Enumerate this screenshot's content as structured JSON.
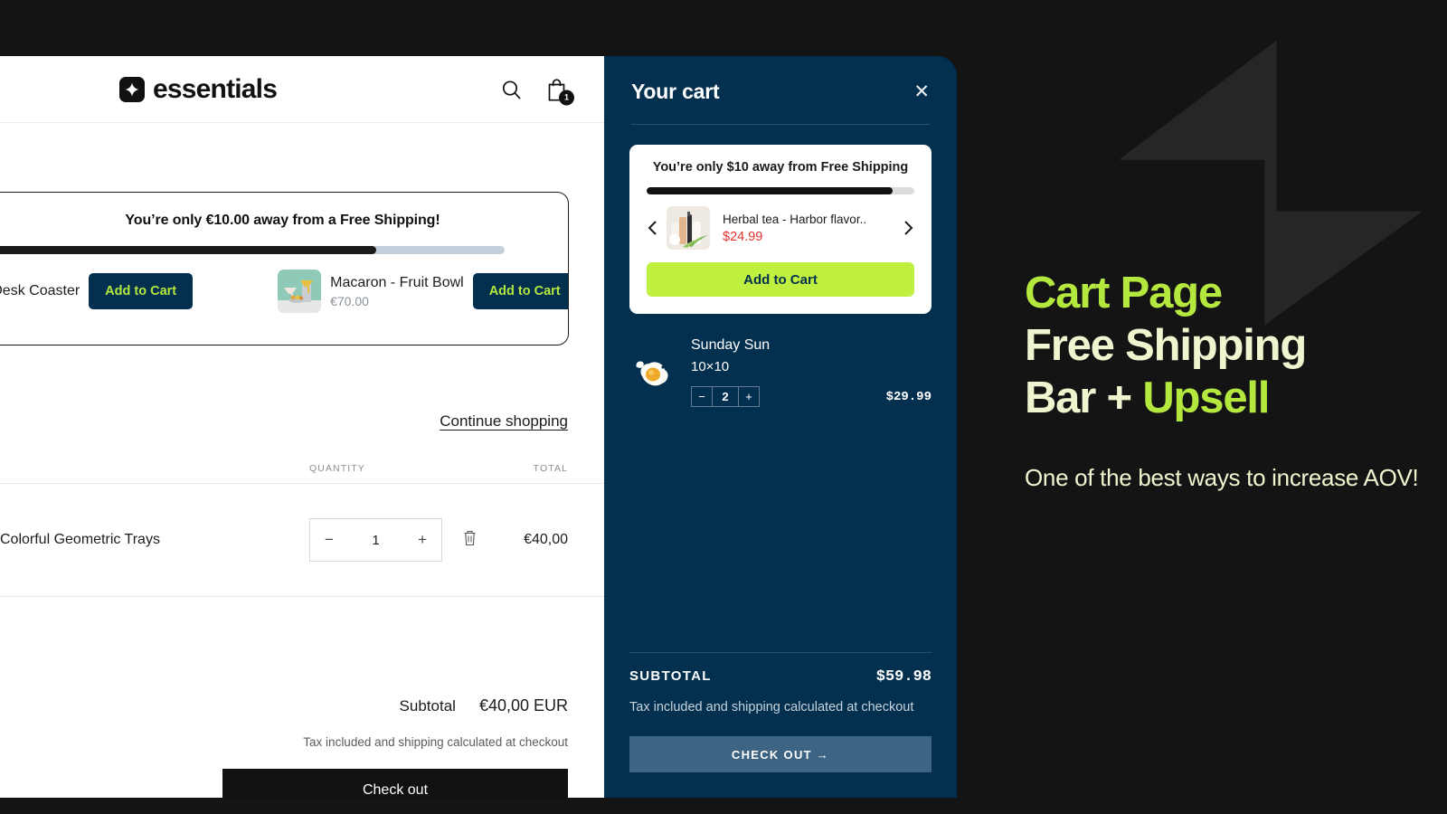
{
  "theme": {
    "page_bg": "#141414",
    "bolt": "#262626",
    "navy": "#04304f",
    "accent_green": "#b5e83f",
    "upsell_green": "#c0f03f",
    "cream": "#edf6cf",
    "price_red": "#e2342f",
    "steel_blue": "#3d6482"
  },
  "cart_page": {
    "header": {
      "logo_word": "essentials",
      "logo_mark_icon": "four-point-star-icon",
      "search_icon": "search-icon",
      "bag_icon": "shopping-bag-icon",
      "bag_count": "1"
    },
    "free_shipping_widget": {
      "title": "You’re only €10.00 away from a Free Shipping!",
      "progress_percent": 76,
      "prev_icon": "chevron-left-icon",
      "next_icon": "chevron-right-icon",
      "slides": [
        {
          "name": "ed Desk Coaster",
          "price": "",
          "add_label": "Add to Cart"
        },
        {
          "name": "Macaron - Fruit Bowl",
          "price": "€70.00",
          "add_label": "Add to Cart"
        }
      ]
    },
    "continue_shopping": "Continue shopping",
    "table": {
      "headers": {
        "product": "",
        "quantity": "QUANTITY",
        "total": "TOTAL"
      },
      "rows": [
        {
          "name": "Colorful Geometric Trays",
          "qty": "1",
          "minus": "−",
          "plus": "+",
          "remove_icon": "trash-icon",
          "total": "€40,00"
        }
      ]
    },
    "totals": {
      "subtotal_label": "Subtotal",
      "subtotal_value": "€40,00 EUR",
      "note": "Tax included and shipping calculated at checkout",
      "checkout_label": "Check out"
    }
  },
  "cart_drawer": {
    "title": "Your cart",
    "close_icon": "close-icon",
    "upsell": {
      "title": "You’re only $10 away from Free Shipping",
      "progress_percent": 92,
      "prev_icon": "chevron-left-icon",
      "next_icon": "chevron-right-icon",
      "product_name": "Herbal tea - Harbor flavor..",
      "product_price": "$24.99",
      "add_label": "Add to Cart"
    },
    "items": [
      {
        "name": "Sunday Sun",
        "variant": "10×10",
        "thumb_icon": "fried-egg-icon",
        "minus": "−",
        "qty": "2",
        "plus": "+",
        "price": "$29.99"
      }
    ],
    "footer": {
      "subtotal_label": "SUBTOTAL",
      "subtotal_value": "$59.98",
      "note": "Tax included and shipping calculated at checkout",
      "checkout_label": "CHECK OUT →"
    }
  },
  "promo": {
    "line1": "Cart Page",
    "line2": "Free Shipping",
    "line3a": "Bar + ",
    "line3b": "Upsell",
    "subtitle": "One of the best ways to increase AOV!"
  }
}
